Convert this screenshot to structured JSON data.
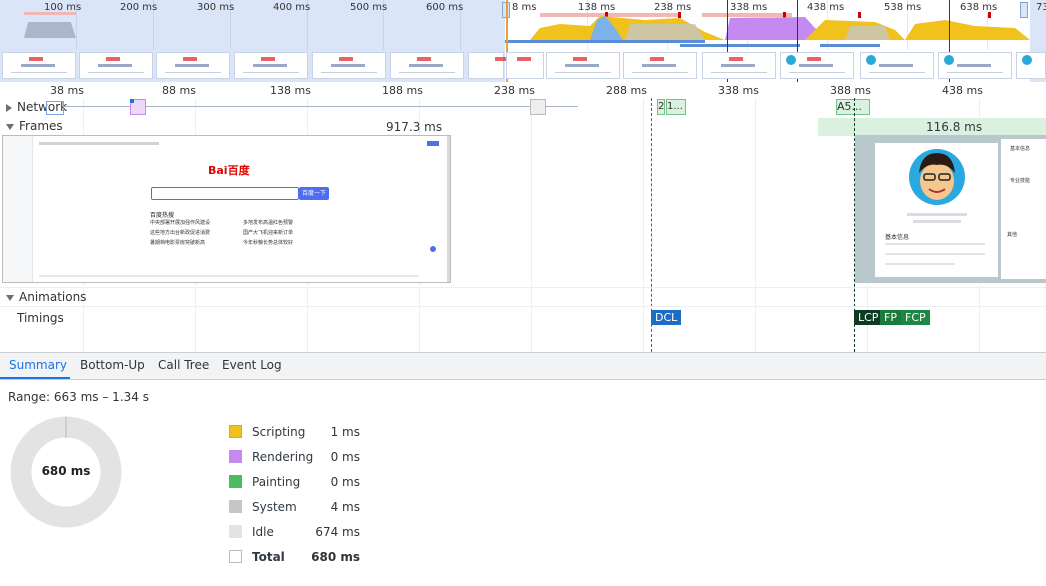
{
  "overview": {
    "left_ticks": [
      "100 ms",
      "200 ms",
      "300 ms",
      "400 ms",
      "500 ms",
      "600 ms"
    ],
    "right_ticks": [
      "8 ms",
      "138 ms",
      "238 ms",
      "338 ms",
      "438 ms",
      "538 ms",
      "638 ms",
      "73"
    ]
  },
  "ruler": {
    "ticks": [
      "38 ms",
      "88 ms",
      "138 ms",
      "188 ms",
      "238 ms",
      "288 ms",
      "338 ms",
      "388 ms",
      "438 ms"
    ]
  },
  "tracks": {
    "network_label": "Network",
    "frames_label": "Frames",
    "animations_label": "Animations",
    "timings_label": "Timings",
    "net_item1": "2",
    "net_item2": "1...",
    "net_item3": "A5...",
    "frame1_duration": "917.3 ms",
    "frame2_duration": "116.8 ms"
  },
  "timing_markers": {
    "dcl": "DCL",
    "lcp": "LCP",
    "fp": "FP",
    "fcp": "FCP"
  },
  "colors": {
    "dcl": "#1c6ec4",
    "lcp": "#0d3a21",
    "fp": "#1b7a3c",
    "fcp": "#1d8743",
    "scripting": "#f1c21b",
    "rendering": "#c58af2",
    "painting": "#4dbb5f",
    "system": "#c6c6c6",
    "idle": "#e3e3e3",
    "accent": "#1a73e8"
  },
  "tabs": [
    "Summary",
    "Bottom-Up",
    "Call Tree",
    "Event Log"
  ],
  "summary": {
    "range": "Range: 663 ms – 1.34 s",
    "donut_total": "680 ms",
    "rows": [
      {
        "value": "1 ms",
        "label": "Scripting"
      },
      {
        "value": "0 ms",
        "label": "Rendering"
      },
      {
        "value": "0 ms",
        "label": "Painting"
      },
      {
        "value": "4 ms",
        "label": "System"
      },
      {
        "value": "674 ms",
        "label": "Idle"
      },
      {
        "value": "680 ms",
        "label": "Total"
      }
    ]
  },
  "baidu_page": {
    "logo_text": "Bai百度",
    "search_button": "百度一下",
    "hot_title": "百度热搜",
    "hot_items": [
      "中央部署开展加强作风建设",
      "这些地方出台新政促进消费",
      "暑期档电影票房突破新高",
      "多地发布高温红色预警",
      "国产大飞机迎来新订单",
      "今年秋粮长势总体较好"
    ]
  },
  "profile_page": {
    "title": "基本信息",
    "side_titles": [
      "基本信息",
      "专业技能",
      "其他"
    ]
  }
}
